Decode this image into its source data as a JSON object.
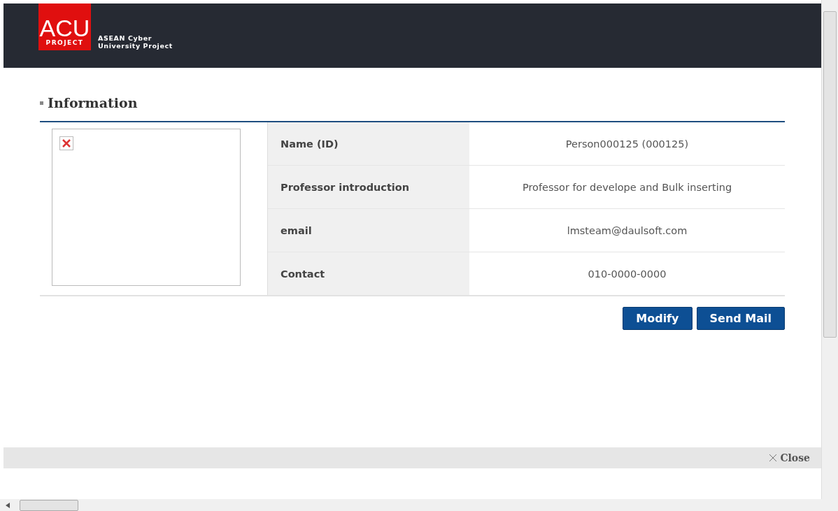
{
  "header": {
    "logo_main": "ACU",
    "logo_sub": "PROJECT",
    "tagline": [
      "ASEAN Cyber",
      "University Project"
    ]
  },
  "section": {
    "title": "Information"
  },
  "photo": {
    "kind": "broken-image"
  },
  "fields": [
    {
      "label": "Name (ID)",
      "value": "Person000125 (000125)"
    },
    {
      "label": "Professor introduction",
      "value": "Professor for develope and Bulk inserting"
    },
    {
      "label": "email",
      "value": "lmsteam@daulsoft.com"
    },
    {
      "label": "Contact",
      "value": "010-0000-0000"
    }
  ],
  "buttons": [
    "Modify",
    "Send Mail"
  ],
  "close": {
    "label": "Close"
  }
}
